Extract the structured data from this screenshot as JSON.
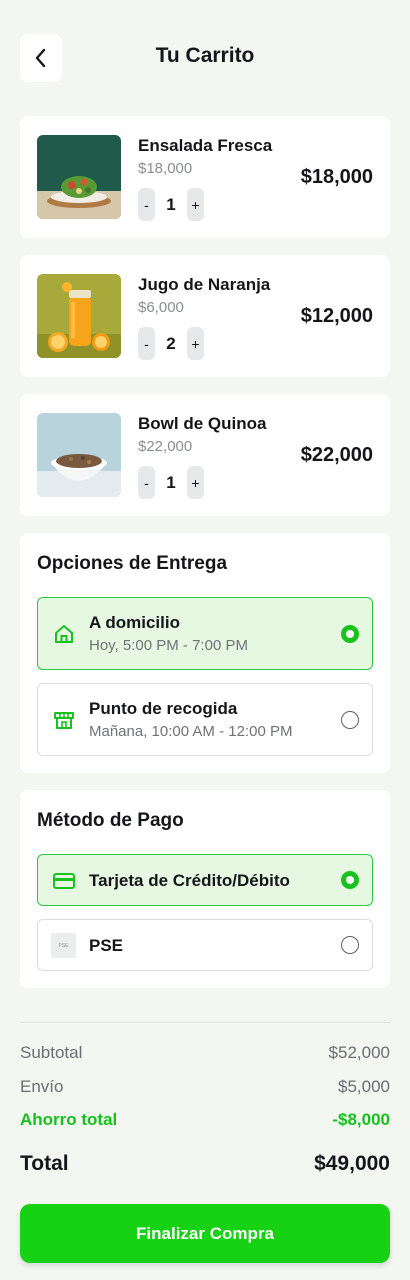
{
  "header": {
    "title": "Tu Carrito",
    "back_icon": "chevron-left-icon"
  },
  "cart_items": [
    {
      "name": "Ensalada Fresca",
      "unit_price": "$18,000",
      "quantity": "1",
      "total": "$18,000",
      "image": "salad-photo"
    },
    {
      "name": "Jugo de Naranja",
      "unit_price": "$6,000",
      "quantity": "2",
      "total": "$12,000",
      "image": "orange-juice-photo"
    },
    {
      "name": "Bowl de Quinoa",
      "unit_price": "$22,000",
      "quantity": "1",
      "total": "$22,000",
      "image": "quinoa-bowl-photo"
    }
  ],
  "stepper": {
    "minus": "-",
    "plus": "+"
  },
  "delivery": {
    "title": "Opciones de Entrega",
    "options": [
      {
        "title": "A domicilio",
        "subtitle": "Hoy, 5:00 PM - 7:00 PM",
        "selected": true,
        "icon": "home-icon"
      },
      {
        "title": "Punto de recogida",
        "subtitle": "Mañana, 10:00 AM - 12:00 PM",
        "selected": false,
        "icon": "store-icon"
      }
    ]
  },
  "payment": {
    "title": "Método de Pago",
    "options": [
      {
        "title": "Tarjeta de Crédito/Débito",
        "selected": true,
        "icon": "credit-card-icon"
      },
      {
        "title": "PSE",
        "selected": false,
        "icon": "pse-logo-icon",
        "logo_text": "PSE"
      }
    ]
  },
  "summary": {
    "subtotal_label": "Subtotal",
    "subtotal_value": "$52,000",
    "shipping_label": "Envío",
    "shipping_value": "$5,000",
    "savings_label": "Ahorro total",
    "savings_value": "-$8,000",
    "total_label": "Total",
    "total_value": "$49,000"
  },
  "checkout_button": "Finalizar Compra",
  "colors": {
    "accent": "#16d114",
    "selected_bg": "#e6f8e2",
    "background": "#f4f6f2"
  }
}
